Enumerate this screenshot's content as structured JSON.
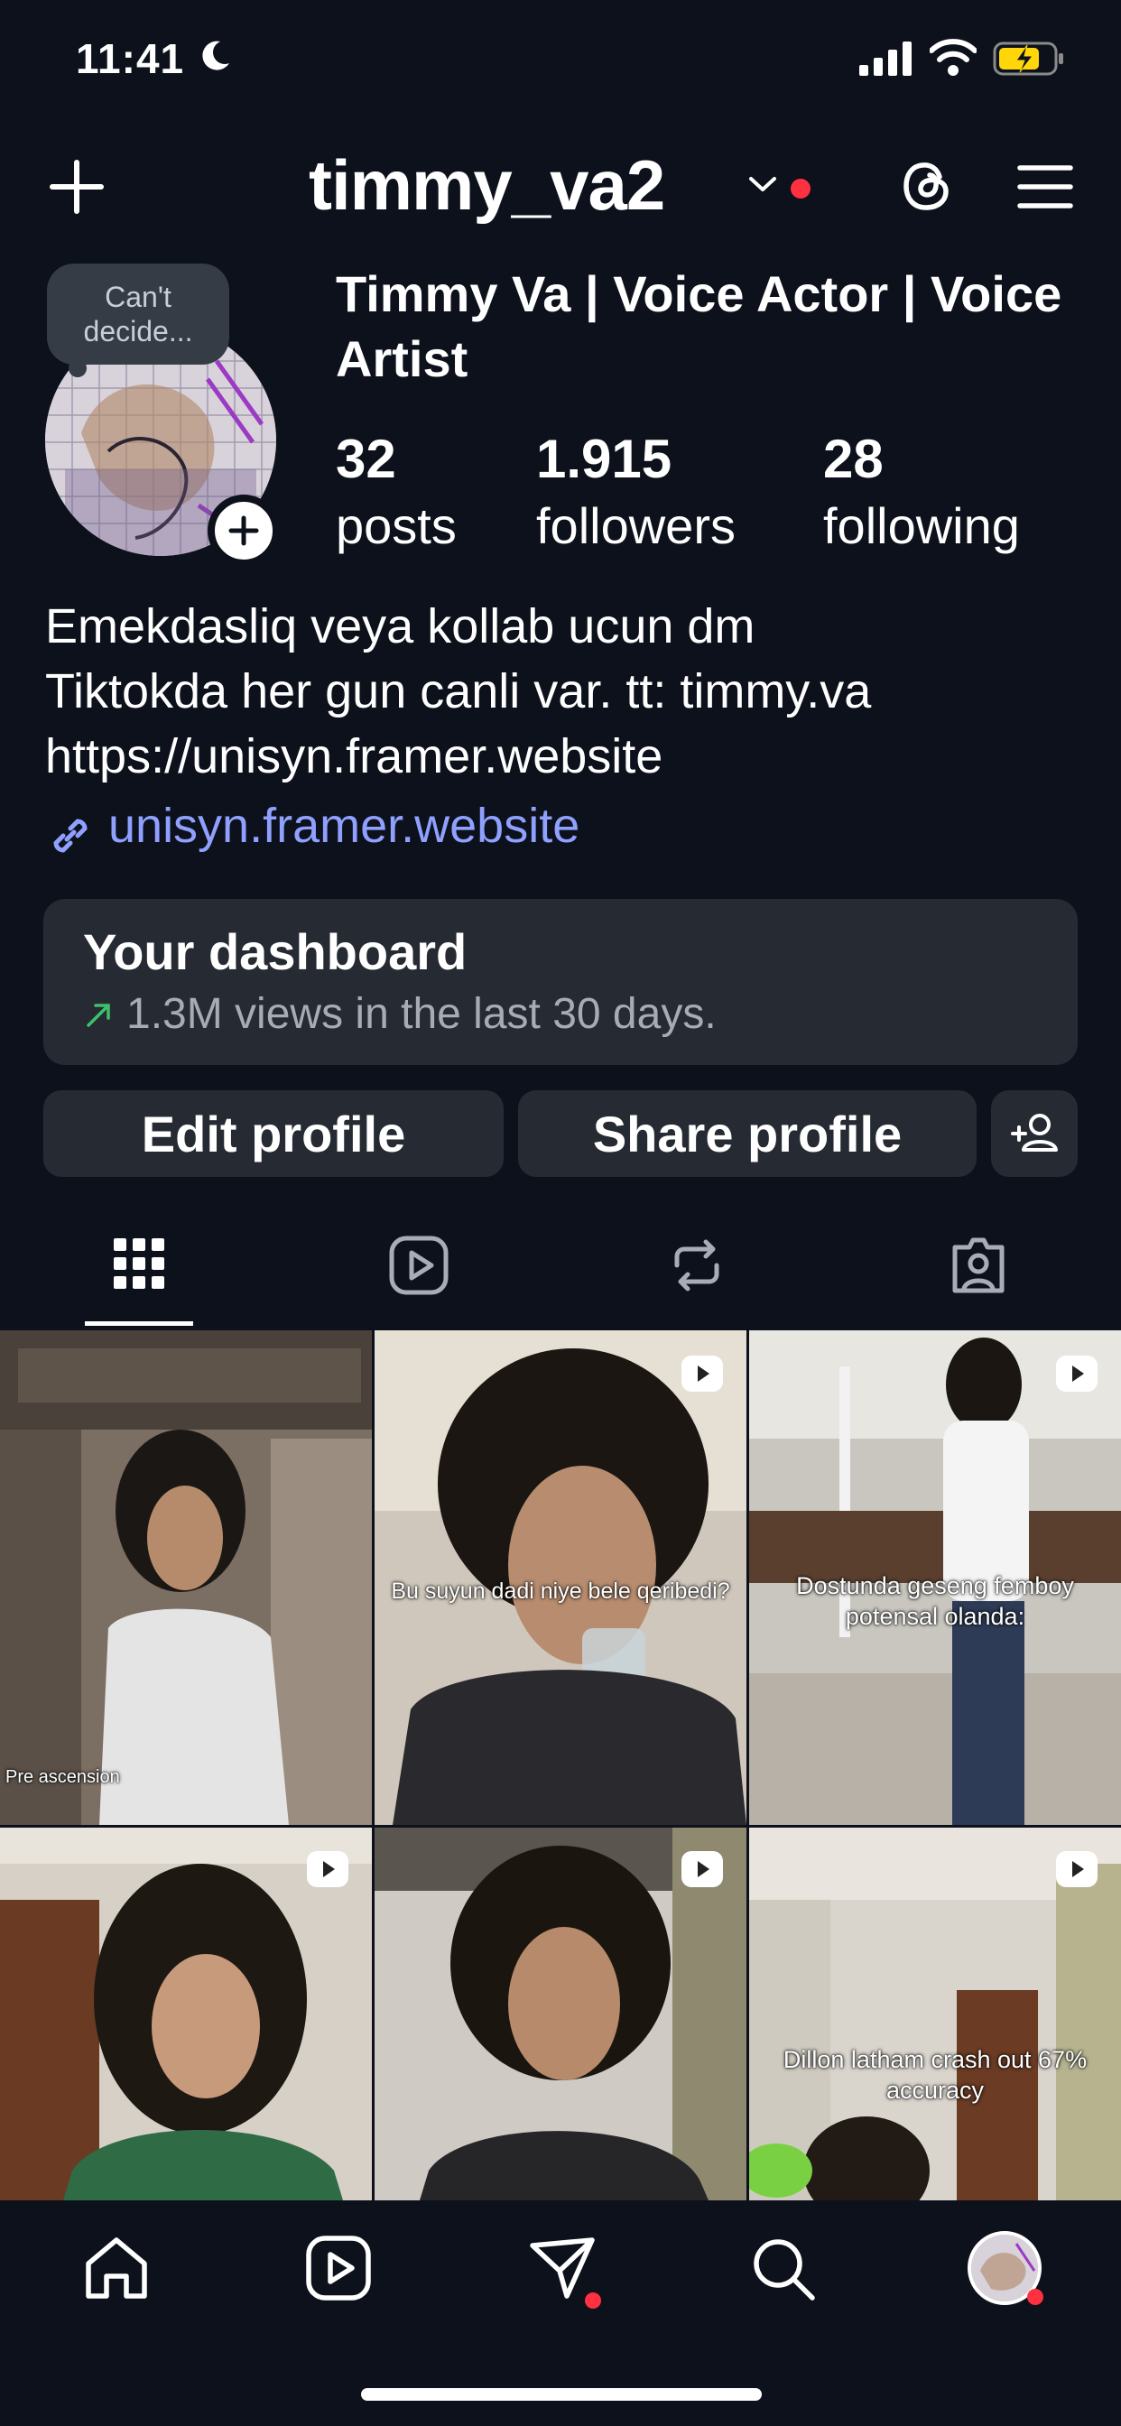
{
  "status_bar": {
    "time": "11:41"
  },
  "header": {
    "username": "timmy_va2"
  },
  "profile": {
    "note": "Can't decide...",
    "display_name": "Timmy Va | Voice Actor | Voice Artist",
    "stats": [
      {
        "num": "32",
        "label": "posts"
      },
      {
        "num": "1.915",
        "label": "followers"
      },
      {
        "num": "28",
        "label": "following"
      }
    ],
    "bio_lines": [
      "Emekdasliq veya kollab ucun dm",
      "Tiktokda her gun canli var. tt: timmy.va",
      "https://unisyn.framer.website"
    ],
    "link": "unisyn.framer.website"
  },
  "dashboard": {
    "title": "Your dashboard",
    "subtitle": "1.3M views in the last 30 days."
  },
  "buttons": {
    "edit": "Edit profile",
    "share": "Share profile"
  },
  "tabs": [
    "grid-icon",
    "reels-icon",
    "reposts-icon",
    "tagged-icon"
  ],
  "grid": [
    {
      "caption": "Pre ascension",
      "reel": false
    },
    {
      "caption": "Bu suyun dadi niye bele qeribedi?",
      "reel": true
    },
    {
      "caption": "Dostunda geseng femboy potensal olanda:",
      "reel": true
    },
    {
      "caption": "",
      "reel": true
    },
    {
      "caption": "",
      "reel": true
    },
    {
      "caption": "Dillon latham crash out 67% accuracy",
      "reel": true
    }
  ],
  "colors": {
    "background": "#0c111b",
    "surface": "#262b33",
    "link": "#8fa0ff",
    "notification": "#ff3040",
    "trend": "#3fbf6b"
  },
  "nav": [
    "home-icon",
    "reels-icon",
    "messages-icon",
    "search-icon",
    "profile-avatar"
  ]
}
